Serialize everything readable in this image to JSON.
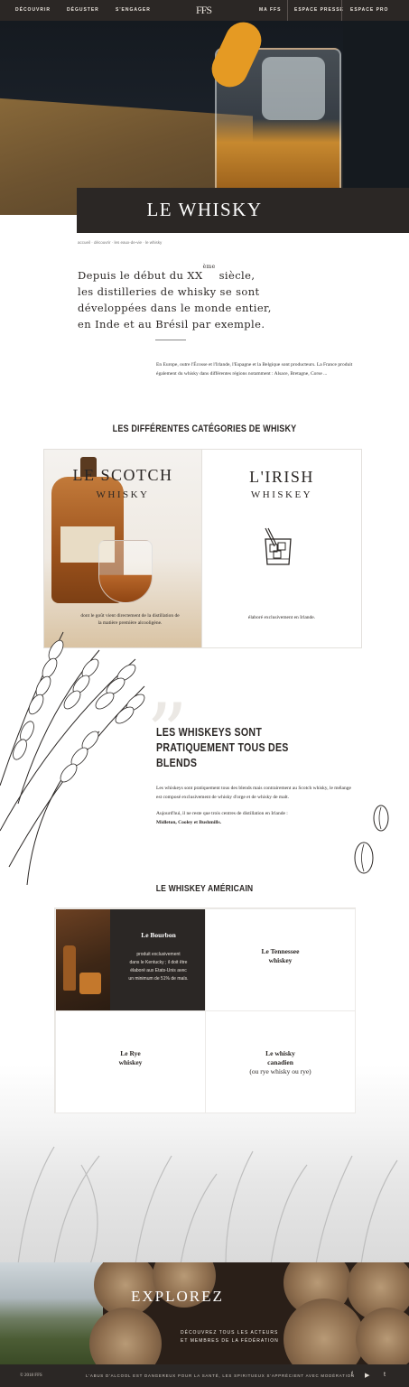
{
  "nav": {
    "left": [
      "DÉCOUVRIR",
      "DÉGUSTER",
      "S'ENGAGER"
    ],
    "logo": "FFS",
    "right": [
      "MA FFS",
      "ESPACE PRESSE",
      "ESPACE PRO"
    ]
  },
  "hero": {
    "title": "LE WHISKY"
  },
  "breadcrumb": "accueil  ·  découvrir  ·  les eaux-de-vie  ·  le whisky",
  "intro": {
    "line1_before": "Depuis le début du XX",
    "line1_sup": "ème",
    "line1_after": " siècle,",
    "line2": "les distilleries de whisky se sont",
    "line3": "développées dans le monde entier,",
    "line4": "en Inde et au Brésil par exemple.",
    "paragraph": "En Europe, outre l'Écosse et l'Irlande, l'Espagne et la Belgique sont producteurs. La France produit également du whisky dans différentes régions notamment : Alsace, Bretagne, Corse ..."
  },
  "categories": {
    "title": "LES DIFFÉRENTES CATÉGORIES DE WHISKY",
    "scotch": {
      "title": "LE SCOTCH",
      "subtitle": "WHISKY",
      "text": "dont le goût  vient directement de la distillation de la matière première alcooligène."
    },
    "irish": {
      "title": "L'IRISH",
      "subtitle": "WHISKEY",
      "text": "élaboré exclusivement en Irlande."
    }
  },
  "blends": {
    "title": "LES WHISKEYS SONT PRATIQUEMENT TOUS DES BLENDS",
    "p1": "Les whiskeys sont pratiquement tous des blends mais contrairement au Scotch whisky, le mélange est composé exclusivement de whisky d'orge et de whisky de malt.",
    "p2": "Aujourd'hui, il ne reste que trois centres de distillation en Irlande :",
    "p2_bold": "Midleton, Cooley et Bushmills."
  },
  "american": {
    "title": "LE WHISKEY AMÉRICAIN",
    "bourbon": {
      "title": "Le Bourbon",
      "desc": [
        "produit exclusivement",
        "dans le Kentucky ; il doit être",
        "élaboré aux Etats-Unis avec",
        "un minimum de 51% de maïs."
      ]
    },
    "tennessee": [
      "Le Tennessee",
      "whiskey"
    ],
    "rye": [
      "Le Rye",
      "whiskey"
    ],
    "canadian": [
      "Le whisky",
      "canadien",
      "(ou rye whisky ou rye)"
    ]
  },
  "explore": {
    "title": "EXPLOREZ",
    "sub1": "DÉCOUVREZ TOUS LES ACTEURS",
    "sub2": "ET MEMBRES DE LA FÉDÉRATION"
  },
  "footer": {
    "copyright": "© 2018 FFS",
    "warning": "L'ABUS D'ALCOOL EST DANGEREUX POUR LA SANTÉ, LES SPIRITUEUX S'APPRÉCIENT AVEC MODÉRATION",
    "social": [
      "f",
      "▶",
      "t"
    ]
  }
}
